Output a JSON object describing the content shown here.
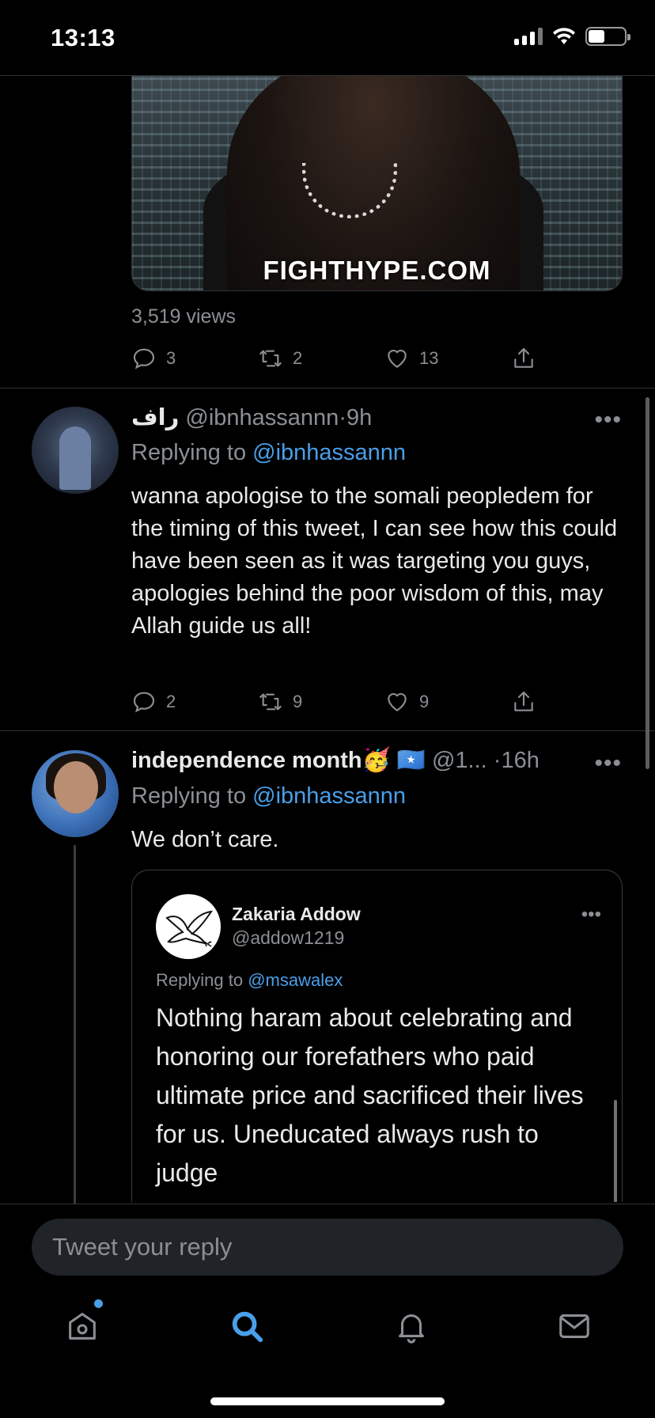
{
  "status_bar": {
    "time": "13:13"
  },
  "top_tweet": {
    "media_watermark": "FIGHTHYPE.COM",
    "views": "3,519 views",
    "actions": {
      "replies": "3",
      "retweets": "2",
      "likes": "13"
    }
  },
  "reply_1": {
    "display_name": "راف",
    "handle": "@ibnhassannn",
    "separator": "·",
    "time": "9h",
    "more": "•••",
    "replying_prefix": "Replying to",
    "replying_handle": "@ibnhassannn",
    "text": "wanna apologise to the somali peopledem for the timing of this tweet, I can see how this could have been seen as it was targeting you guys, apologies behind the poor wisdom of this, may Allah guide us all!",
    "actions": {
      "replies": "2",
      "retweets": "9",
      "likes": "9"
    }
  },
  "reply_2": {
    "display_name": "independence month",
    "emoji": "🥳",
    "flag": "🇸🇴",
    "handle": "@1...",
    "separator": "·",
    "time": "16h",
    "more": "•••",
    "replying_prefix": "Replying to",
    "replying_handle": "@ibnhassannn",
    "text": "We don’t care."
  },
  "quoted_tweet": {
    "display_name": "Zakaria Addow",
    "handle": "@addow1219",
    "more": "•••",
    "replying_prefix": "Replying to",
    "replying_handle": "@msawalex",
    "text": "Nothing haram about celebrating and honoring our forefathers who paid ultimate price and sacrificed their lives for us. Uneducated always rush to judge"
  },
  "reply_composer": {
    "placeholder": "Tweet your reply"
  },
  "tab_bar": {
    "icons": [
      "home-icon",
      "search-icon",
      "notifications-icon",
      "messages-icon"
    ],
    "active": "search-icon"
  },
  "colors": {
    "accent": "#4a9fe9",
    "background": "#000000",
    "muted_text": "#8b8f94"
  }
}
